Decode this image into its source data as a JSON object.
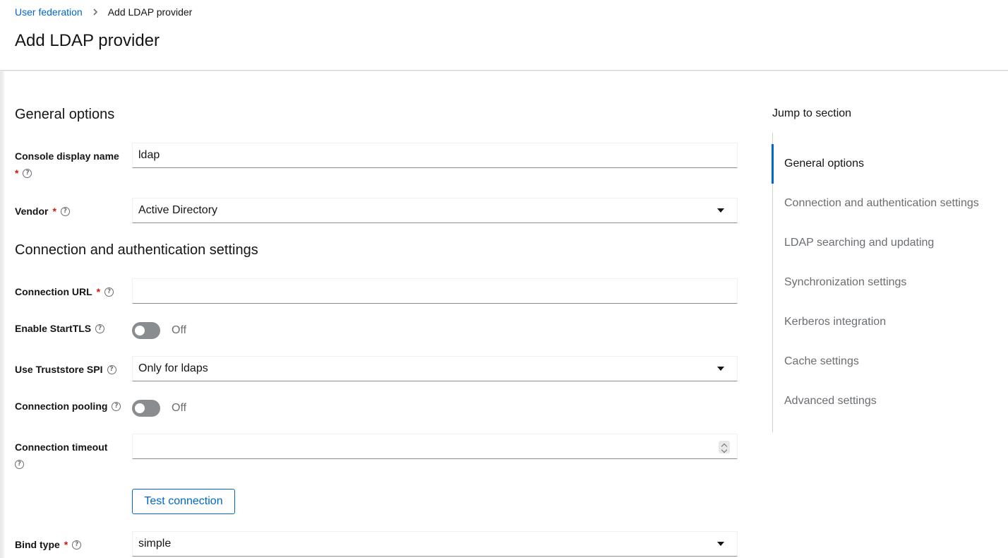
{
  "breadcrumb": {
    "parent": "User federation",
    "current": "Add LDAP provider"
  },
  "page_title": "Add LDAP provider",
  "sections": {
    "general": "General options",
    "connection": "Connection and authentication settings"
  },
  "fields": {
    "console_display_name": {
      "label": "Console display name",
      "value": "ldap"
    },
    "vendor": {
      "label": "Vendor",
      "value": "Active Directory"
    },
    "connection_url": {
      "label": "Connection URL",
      "value": ""
    },
    "enable_starttls": {
      "label": "Enable StartTLS",
      "state": "Off"
    },
    "use_truststore_spi": {
      "label": "Use Truststore SPI",
      "value": "Only for ldaps"
    },
    "connection_pooling": {
      "label": "Connection pooling",
      "state": "Off"
    },
    "connection_timeout": {
      "label": "Connection timeout",
      "value": ""
    },
    "bind_type": {
      "label": "Bind type",
      "value": "simple"
    }
  },
  "required_mark": "*",
  "help_glyph": "?",
  "buttons": {
    "test_connection": "Test connection"
  },
  "jump": {
    "title": "Jump to section",
    "items": [
      "General options",
      "Connection and authentication settings",
      "LDAP searching and updating",
      "Synchronization settings",
      "Kerberos integration",
      "Cache settings",
      "Advanced settings"
    ],
    "active_index": 0
  },
  "colors": {
    "link": "#0066cc",
    "required": "#c9190b",
    "active_nav": "#0066cc"
  }
}
